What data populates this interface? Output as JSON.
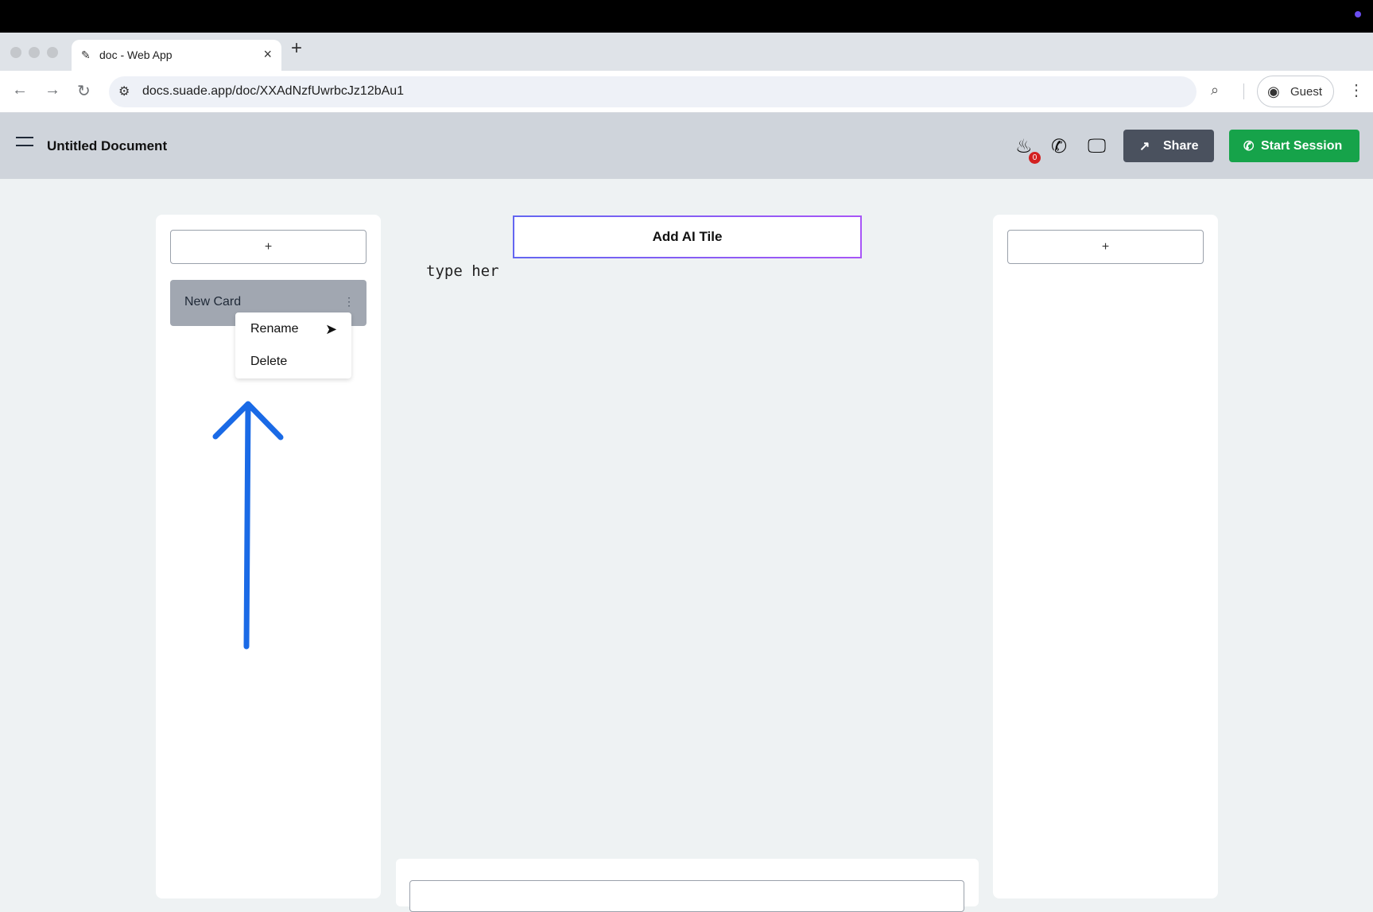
{
  "browser": {
    "tab_title": "doc - Web App",
    "tab_favicon": "pen-nib-icon",
    "new_tab_symbol": "+",
    "url": "docs.suade.app/doc/XXAdNzfUwrbcJz12bAu1",
    "profile_label": "Guest"
  },
  "header": {
    "document_title": "Untitled Document",
    "notification_count": "0",
    "share_label": "Share",
    "start_session_label": "Start Session",
    "accent_green": "#16a34a",
    "share_bg": "#4a515e"
  },
  "left_panel": {
    "add_label": "+",
    "card_label": "New Card",
    "card_menu_symbol": "⋮",
    "context_menu": [
      "Rename",
      "Delete"
    ]
  },
  "center": {
    "ai_tile_label": "Add AI Tile",
    "editor_text": "type her"
  },
  "right_panel": {
    "add_label": "+"
  },
  "annotation": {
    "arrow_color": "#1a6ae6"
  }
}
